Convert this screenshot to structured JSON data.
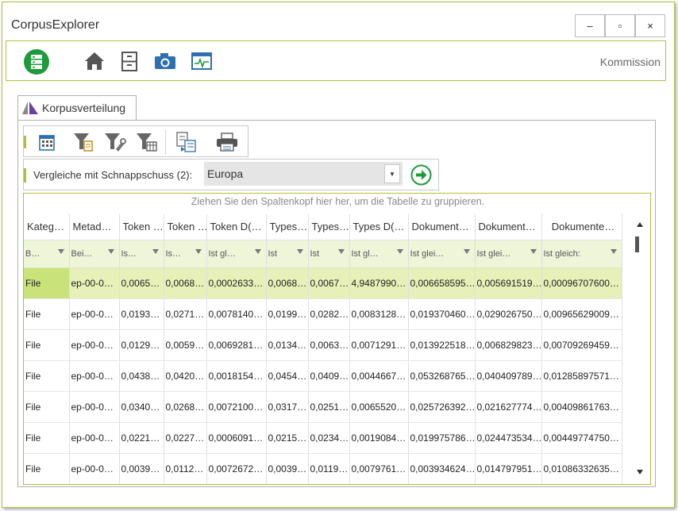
{
  "app": {
    "title": "CorpusExplorer",
    "ribbon_label": "Kommission"
  },
  "window_controls": {
    "minimize": "‒",
    "maximize": "▫",
    "close": "×"
  },
  "ribbon_icons": [
    "database-icon",
    "home-icon",
    "cabinet-icon",
    "camera-icon",
    "monitor-icon"
  ],
  "tab": {
    "label": "Korpusverteilung"
  },
  "toolbar": {
    "icons": [
      "calendar-grid-icon",
      "filter-note-icon",
      "filter-tool-icon",
      "filter-table-icon",
      "export-icon",
      "print-icon"
    ]
  },
  "compare": {
    "label": "Vergleiche mit Schnappschuss (2):",
    "value": "Europa"
  },
  "grid": {
    "group_hint": "Ziehen Sie den Spaltenkopf hier her, um die Tabelle zu gruppieren.",
    "columns": [
      "Kateg…",
      "Metad…",
      "Token …",
      "Token …",
      "Token  D(…",
      "Types…",
      "Types…",
      "Types  D(…",
      "Dokument…",
      "Dokument…",
      "Dokumente…"
    ],
    "filters": [
      "B…",
      "Bei…",
      "Is…",
      "Is…",
      "Ist gl…",
      "Ist",
      "Ist",
      "Ist gl…",
      "Ist glei…",
      "Ist glei…",
      "Ist gleich:"
    ],
    "rows": [
      [
        "File",
        "ep-00-0…",
        "0,0065…",
        "0,0068…",
        "0,0002633…",
        "0,0068…",
        "0,0067…",
        "4,9487990…",
        "0,006658595…",
        "0,005691519…",
        "0,00096707600…"
      ],
      [
        "File",
        "ep-00-0…",
        "0,0193…",
        "0,0271…",
        "0,0078140…",
        "0,0199…",
        "0,0282…",
        "0,0083128…",
        "0,019370460…",
        "0,029026750…",
        "0,00965629009…"
      ],
      [
        "File",
        "ep-00-0…",
        "0,0129…",
        "0,0059…",
        "0,0069281…",
        "0,0134…",
        "0,0063…",
        "0,0071291…",
        "0,013922518…",
        "0,006829823…",
        "0,00709269459…"
      ],
      [
        "File",
        "ep-00-0…",
        "0,0438…",
        "0,0420…",
        "0,0018154…",
        "0,0454…",
        "0,0409…",
        "0,0044667…",
        "0,053268765…",
        "0,040409789…",
        "0,01285897571…"
      ],
      [
        "File",
        "ep-00-0…",
        "0,0340…",
        "0,0268…",
        "0,0072100…",
        "0,0317…",
        "0,0251…",
        "0,0065520…",
        "0,025726392…",
        "0,021627774…",
        "0,00409861763…"
      ],
      [
        "File",
        "ep-00-0…",
        "0,0221…",
        "0,0227…",
        "0,0006091…",
        "0,0215…",
        "0,0234…",
        "0,0019084…",
        "0,019975786…",
        "0,024473534…",
        "0,00449774750…"
      ],
      [
        "File",
        "ep-00-0…",
        "0,0039…",
        "0,0112…",
        "0,0072672…",
        "0,0039…",
        "0,0119…",
        "0,0079761…",
        "0,003934624…",
        "0,014797951…",
        "0,01086332635…"
      ]
    ],
    "selected_row": 0
  },
  "colors": {
    "accent": "#a9c23f",
    "selected_cell": "#c9e27a",
    "selected_row": "#e6f0b8",
    "filter_row": "#eef5d9",
    "icon_blue": "#2f6fb0",
    "icon_green": "#1e9a3c"
  }
}
